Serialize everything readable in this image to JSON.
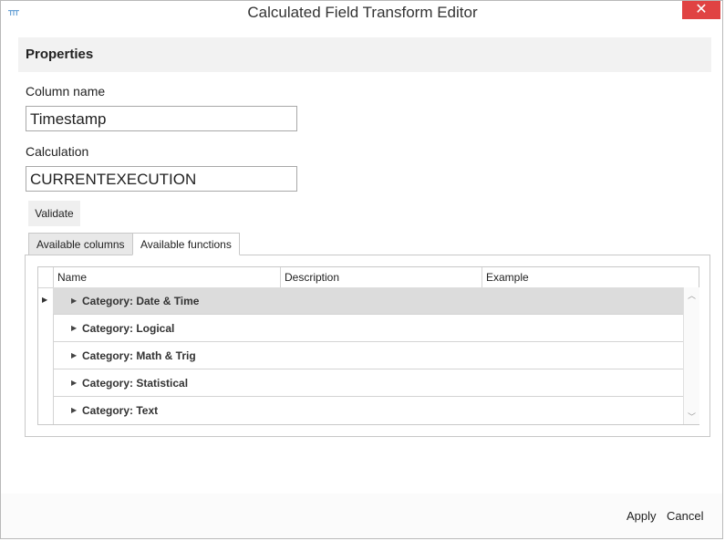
{
  "window": {
    "title": "Calculated Field Transform Editor",
    "close_glyph": "✕"
  },
  "properties": {
    "header": "Properties",
    "column_name_label": "Column name",
    "column_name_value": "Timestamp",
    "calculation_label": "Calculation",
    "calculation_value": "CURRENTEXECUTION",
    "validate_label": "Validate"
  },
  "tabs": [
    {
      "label": "Available columns",
      "active": false
    },
    {
      "label": "Available functions",
      "active": true
    }
  ],
  "grid": {
    "columns": [
      "Name",
      "Description",
      "Example"
    ],
    "rows": [
      {
        "label": "Category: Date & Time",
        "selected": true
      },
      {
        "label": "Category: Logical",
        "selected": false
      },
      {
        "label": "Category: Math & Trig",
        "selected": false
      },
      {
        "label": "Category: Statistical",
        "selected": false
      },
      {
        "label": "Category: Text",
        "selected": false
      }
    ]
  },
  "footer": {
    "apply_label": "Apply",
    "cancel_label": "Cancel"
  },
  "colors": {
    "close_button": "#e04343",
    "selected_row": "#dcdcdc",
    "header_bg": "#f2f2f2"
  }
}
